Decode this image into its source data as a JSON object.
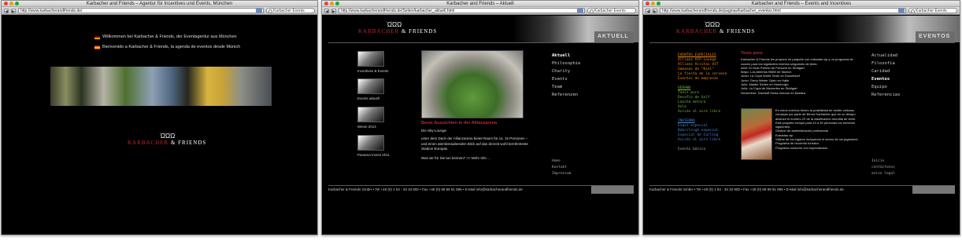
{
  "windows": [
    {
      "title": "Karbacher and Friends – Agentur für Incentives und Events, München",
      "url": "http://www.karbacherandfriends.de/",
      "search": "Karbacher Events",
      "languages": [
        "Willkommen bei Karbacher & Friends, der Eventagentur aus München",
        "Bienvenido a Karbacher & Friends, la agenda de eventos desde Múnich"
      ],
      "logo_glyphs": "ῺῺῺ",
      "brand_red": "KARBACHER",
      "brand_white": "& FRIENDS"
    },
    {
      "title": "Karbacher and Friends – Aktuell",
      "url": "http://www.karbacherandfriends.de/Seiten/karbacher_aktuell.html",
      "search": "Karbacher Events",
      "logo_glyphs": "ῺῺῺ",
      "brand_red": "KARBACHER",
      "brand_white": "& FRIENDS",
      "section": "AKTUELL",
      "thumbs": [
        "Incentives & Events",
        "Events aktuell",
        "Wiesn 2014",
        "Panama Invest 2011"
      ],
      "menu": [
        "Aktuell",
        "Philosophie",
        "Charity",
        "Events",
        "Team",
        "Referenzen"
      ],
      "sub_menu": [
        "Home",
        "Kontakt",
        "Impressum"
      ],
      "headline": "Beste Aussichten in der Allianzarena",
      "subheadline": "Die Sky-Lounge",
      "body": "unter dem Dach der Allianzarena bietet Raum für ca. 15 Personen – und einen atemberaubenden Blick auf das derzeit wohl berühmteste Stadion Europas.",
      "question": "Was wir für Sie tun können? >> Mehr Info ...",
      "footer": "Karbacher & Friends GmbH • Tel +49 (0) 1 63 - 33 33 900 • Fax +49 (0) 89 99 91 996 • E-Mail info@karbacherandfriends.de"
    },
    {
      "title": "Karbacher and Friends – Events and Incentives",
      "url": "http://www.karbacherandfriends.de/paginas/karbacher_eventos.html",
      "search": "Karbacher Events",
      "logo_glyphs": "ῺῺῺ",
      "brand_red": "KARBACHER",
      "brand_white": "& FRIENDS",
      "section": "EVENTOS",
      "left_orange_title": "EVENTOS ESPECIALES",
      "left_orange": [
        "Allianz VIP-Lounge",
        "Allianz Visitas VIT",
        "Semanas de \"Kiel\"",
        "La fiesta de la cerveza",
        "Eventos de empresas"
      ],
      "left_green_title": "VERANO",
      "left_green": [
        "Tenis puro",
        "Desafío de Golf",
        "Lancha motora",
        "Vela",
        "Acción al aire libre"
      ],
      "left_blue_title": "INVIERNO",
      "left_blue": [
        "Esquí especial",
        "Bob/sleigh especial",
        "Especial de Curling",
        "Acción al aire libre"
      ],
      "left_footer": "Evento básico",
      "menu": [
        "Actualidad",
        "Filosofía",
        "Caridad",
        "Eventos",
        "Equipo",
        "Referencias"
      ],
      "sub_menu": [
        "Inicio",
        "contáctenos",
        "aviso legal"
      ],
      "headline": "Tenis puro",
      "intro": "Karbacher & Friends les propone un paquete con entradas vip y un programa de cuadro para los siguientes eventos singulares de tenis:",
      "events": [
        "Abril: El Gran Premio de Porsche en Stuttgart",
        "Mayo: Los Abiertos BMW de Múnich",
        "Junio: La Copa World Team en Dusseldorf",
        "Junio: Gerry Weber Open en Halle",
        "Julio: Master Series en Hamburgo",
        "Julio: La Copa de Mercedes en Stuttgart",
        "Noviembre: Davidoff Swiss Indoors en Basilea"
      ],
      "text2": "En estos eventos tienen la posibilidad de recibir valiosos consejos por parte de Bernd Karbacher que en su tiempo alcanzó el número 22 de la clasificación mundial de tenis.",
      "text3": "Este paquete incluye para 10 a 30 personas los servicios siguientes:",
      "services": [
        "Gestión de administración profesional",
        "Entradas vip",
        "Visitas de los lugares incluyendo el sector de los jugadores",
        "Programa de recorrido turístico",
        "Programa nocturno con espectáculos"
      ],
      "footer": "Karbacher & Friends GmbH • Tel +49 (0) 1 63 - 33 33 900 • Fax +49 (0) 89 99 91 996 • E-Mail info@karbacherandfriends.de"
    }
  ]
}
